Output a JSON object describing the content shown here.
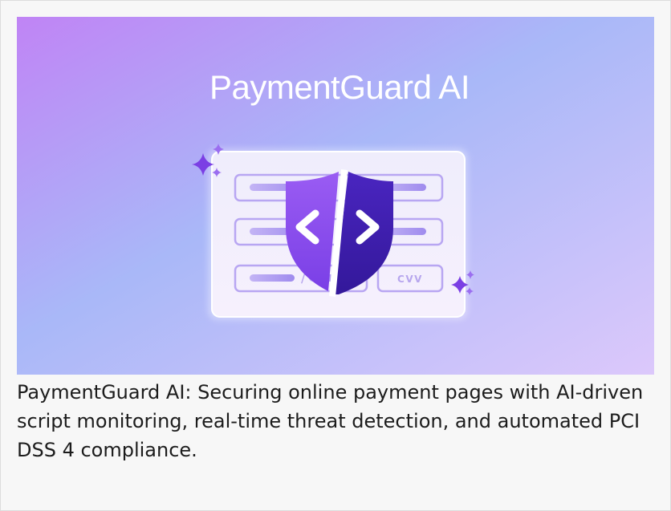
{
  "hero": {
    "title": "PaymentGuard AI",
    "card_field_separator": "/",
    "cvv_label": "CVV",
    "colors": {
      "gradient_start": "#c084f5",
      "gradient_mid": "#a9b8f8",
      "gradient_end": "#dcc8fb",
      "shield_left": "#8a4cf0",
      "shield_right": "#3a1fa8",
      "sparkle": "#7b3fe4"
    },
    "icons": [
      "shield-code-icon",
      "sparkle-icon",
      "payment-form-card"
    ]
  },
  "caption": {
    "text": "PaymentGuard AI: Securing online payment pages with AI-driven script monitoring, real-time threat detection, and automated PCI DSS 4 compliance."
  }
}
